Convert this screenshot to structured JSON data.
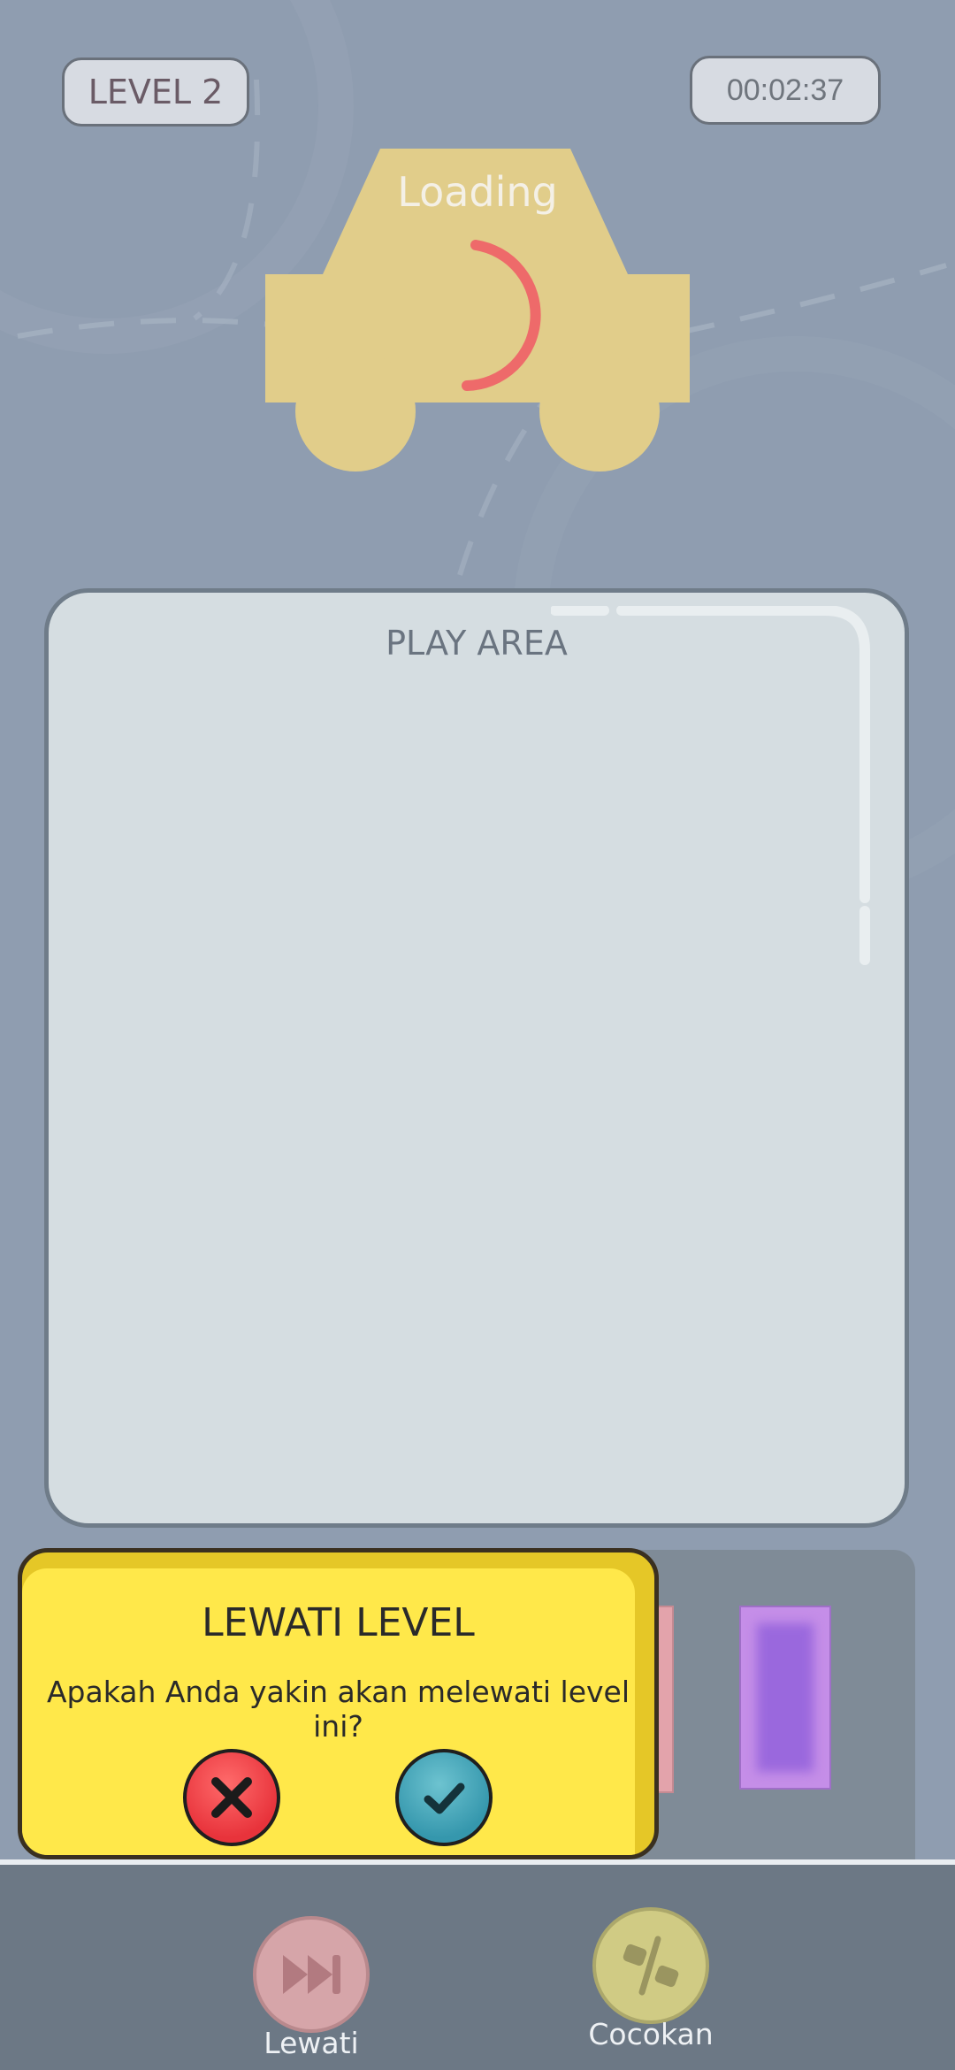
{
  "header": {
    "level_label": "LEVEL 2",
    "timer": "00:02:37"
  },
  "loading": {
    "text": "Loading"
  },
  "play_area": {
    "label": "PLAY AREA"
  },
  "dialog": {
    "title": "LEWATI LEVEL",
    "message": "Apakah Anda yakin akan melewati level ini?",
    "cancel_icon": "close-icon",
    "confirm_icon": "check-icon"
  },
  "bottom_bar": {
    "skip_label": "Lewati",
    "skip_icon": "fast-forward-icon",
    "match_label": "Cocokan",
    "match_icon": "match-icon"
  },
  "colors": {
    "background": "#8f9db0",
    "car": "#e1cd8a",
    "dialog_yellow": "#ffe84a",
    "cancel_red": "#e8333b",
    "confirm_teal": "#3597ad"
  }
}
